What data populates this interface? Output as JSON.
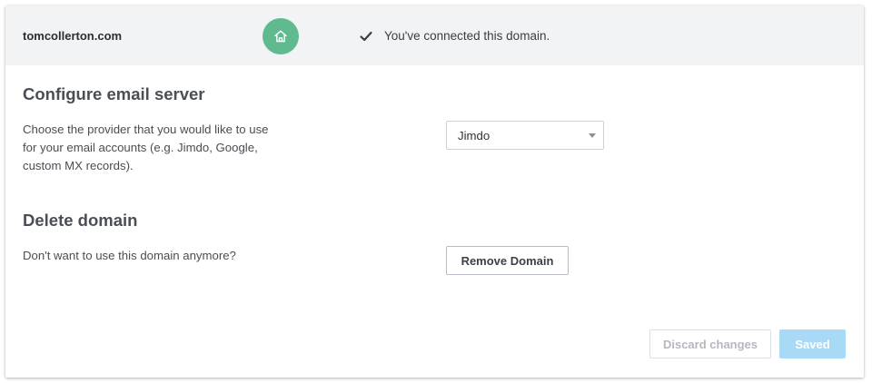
{
  "header": {
    "domain": "tomcollerton.com",
    "home_icon": "home-icon",
    "check_icon": "check-icon",
    "status_text": "You've connected this domain."
  },
  "email_server": {
    "title": "Configure email server",
    "description_lines": [
      "Choose the provider that you would like to use",
      "for your email accounts (e.g. Jimdo, Google,",
      "custom MX records)."
    ],
    "selected_provider": "Jimdo"
  },
  "delete_domain": {
    "title": "Delete domain",
    "description": "Don't want to use this domain anymore?",
    "button_label": "Remove Domain"
  },
  "footer": {
    "discard_label": "Discard changes",
    "saved_label": "Saved"
  },
  "colors": {
    "home_badge": "#5fbb8f",
    "saved_button": "#a8daf5",
    "header_bg": "#f2f3f5"
  }
}
